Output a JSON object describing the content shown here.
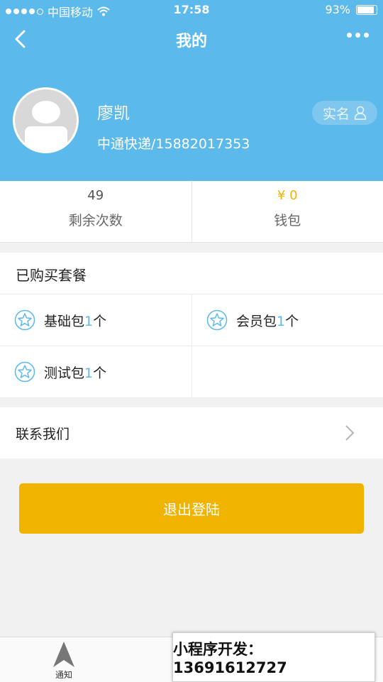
{
  "status": {
    "carrier": "中国移动",
    "time": "17:58",
    "battery": "93%"
  },
  "nav": {
    "title": "我的"
  },
  "profile": {
    "name": "廖凯",
    "info": "中通快递/15882017353",
    "realname_label": "实名"
  },
  "stats": [
    {
      "value": "49",
      "label": "剩余次数"
    },
    {
      "value": "¥ 0",
      "label": "钱包"
    }
  ],
  "packages": {
    "title": "已购买套餐",
    "items": [
      {
        "name": "基础包",
        "count": "1",
        "unit": "个"
      },
      {
        "name": "会员包",
        "count": "1",
        "unit": "个"
      },
      {
        "name": "测试包",
        "count": "1",
        "unit": "个"
      }
    ]
  },
  "contact": {
    "label": "联系我们"
  },
  "logout": {
    "label": "退出登陆"
  },
  "tabbar": {
    "tab1_label": "通知"
  },
  "banner": {
    "text": "小程序开发：13691612727"
  },
  "colors": {
    "brand_blue": "#5bb9ec",
    "accent_yellow": "#f0b400"
  },
  "icons": [
    "wifi-icon",
    "back-icon",
    "more-icon",
    "user-icon",
    "star-icon",
    "chevron-right-icon",
    "navigation-icon"
  ]
}
